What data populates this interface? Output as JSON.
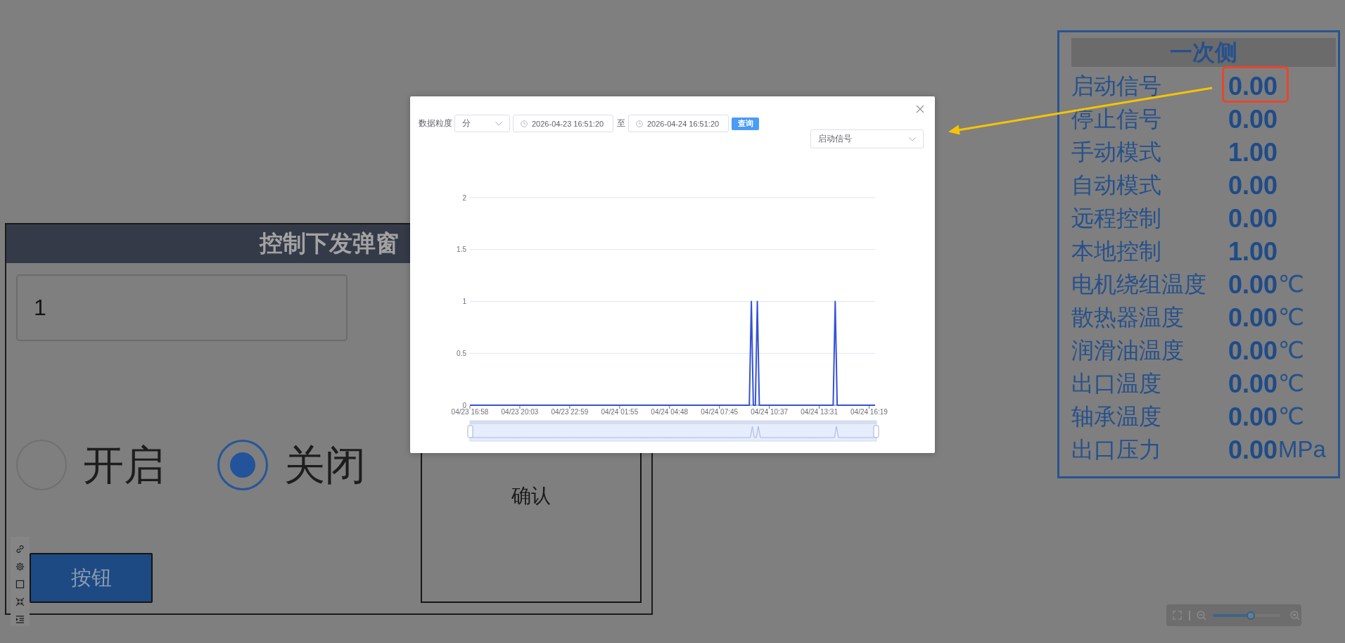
{
  "signal_panel": {
    "title": "一次侧",
    "rows": [
      {
        "label": "启动信号",
        "value": "0.00",
        "highlighted": true
      },
      {
        "label": "停止信号",
        "value": "0.00",
        "highlighted": false
      },
      {
        "label": "手动模式",
        "value": "1.00",
        "highlighted": false
      },
      {
        "label": "自动模式",
        "value": "0.00",
        "highlighted": false
      },
      {
        "label": "远程控制",
        "value": "0.00",
        "highlighted": false
      },
      {
        "label": "本地控制",
        "value": "1.00",
        "highlighted": false
      },
      {
        "label": "电机绕组温度",
        "value": "0.00",
        "unit": "℃",
        "highlighted": false
      },
      {
        "label": "散热器温度",
        "value": "0.00",
        "unit": "℃",
        "highlighted": false
      },
      {
        "label": "润滑油温度",
        "value": "0.00",
        "unit": "℃",
        "highlighted": false
      },
      {
        "label": "出口温度",
        "value": "0.00",
        "unit": "℃",
        "highlighted": false
      },
      {
        "label": "轴承温度",
        "value": "0.00",
        "unit": "℃",
        "highlighted": false
      },
      {
        "label": "出口压力",
        "value": "0.00",
        "unit": "MPa",
        "highlighted": false
      }
    ]
  },
  "history_dialog": {
    "granularity_label": "数据粒度",
    "granularity": "分",
    "start_time": "2026-04-23 16:51:20",
    "range_separator": "至",
    "end_time": "2026-04-24 16:51:20",
    "query_button": "查询",
    "signal": "启动信号",
    "chart_data": {
      "type": "line",
      "grid": true,
      "categories": [
        "04/23 16:58",
        null,
        null,
        null,
        null,
        null,
        null,
        null,
        null,
        null,
        null,
        null,
        null,
        null,
        null,
        null,
        null,
        null,
        null,
        null,
        null,
        null,
        null,
        null,
        null,
        "04/23 20:03",
        null,
        null,
        null,
        null,
        null,
        null,
        null,
        null,
        null,
        null,
        null,
        null,
        null,
        null,
        null,
        null,
        null,
        null,
        null,
        null,
        null,
        null,
        null,
        null,
        "04/23 22:59",
        null,
        null,
        null,
        null,
        null,
        null,
        null,
        null,
        null,
        null,
        null,
        null,
        null,
        null,
        null,
        null,
        null,
        null,
        null,
        null,
        null,
        null,
        null,
        null,
        "04/24 01:55",
        null,
        null,
        null,
        null,
        null,
        null,
        null,
        null,
        null,
        null,
        null,
        null,
        null,
        null,
        null,
        null,
        null,
        null,
        null,
        null,
        null,
        null,
        null,
        null,
        "04/24 04:48",
        null,
        null,
        null,
        null,
        null,
        null,
        null,
        null,
        null,
        null,
        null,
        null,
        null,
        null,
        null,
        null,
        null,
        null,
        null,
        null,
        null,
        null,
        null,
        null,
        "04/24 07:45",
        null,
        null,
        null,
        null,
        null,
        null,
        null,
        null,
        null,
        null,
        null,
        null,
        null,
        null,
        null,
        null,
        null,
        null,
        null,
        null,
        null,
        null,
        null,
        null,
        "04/24 10:37",
        null,
        null,
        null,
        null,
        null,
        null,
        null,
        null,
        null,
        null,
        null,
        null,
        null,
        null,
        null,
        null,
        null,
        null,
        null,
        null,
        null,
        null,
        null,
        null,
        "04/24 13:31",
        null,
        null,
        null,
        null,
        null,
        null,
        null,
        null,
        null,
        null,
        null,
        null,
        null,
        null,
        null,
        null,
        null,
        null,
        null,
        null,
        null,
        null,
        null,
        null,
        "04/24 16:19",
        null,
        null,
        null
      ],
      "values": [
        0,
        0,
        0,
        0,
        0,
        0,
        0,
        0,
        0,
        0,
        0,
        0,
        0,
        0,
        0,
        0,
        0,
        0,
        0,
        0,
        0,
        0,
        0,
        0,
        0,
        0,
        0,
        0,
        0,
        0,
        0,
        0,
        0,
        0,
        0,
        0,
        0,
        0,
        0,
        0,
        0,
        0,
        0,
        0,
        0,
        0,
        0,
        0,
        0,
        0,
        0,
        0,
        0,
        0,
        0,
        0,
        0,
        0,
        0,
        0,
        0,
        0,
        0,
        0,
        0,
        0,
        0,
        0,
        0,
        0,
        0,
        0,
        0,
        0,
        0,
        0,
        0,
        0,
        0,
        0,
        0,
        0,
        0,
        0,
        0,
        0,
        0,
        0,
        0,
        0,
        0,
        0,
        0,
        0,
        0,
        0,
        0,
        0,
        0,
        0,
        0,
        0,
        0,
        0,
        0,
        0,
        0,
        0,
        0,
        0,
        0,
        0,
        0,
        0,
        0,
        0,
        0,
        0,
        0,
        0,
        0,
        0,
        0,
        0,
        0,
        0,
        0,
        0,
        0,
        0,
        0,
        0,
        0,
        0,
        0,
        0,
        0,
        0,
        0,
        0,
        0,
        1,
        0,
        0,
        1,
        0,
        0,
        0,
        0,
        0,
        0,
        0,
        0,
        0,
        0,
        0,
        0,
        0,
        0,
        0,
        0,
        0,
        0,
        0,
        0,
        0,
        0,
        0,
        0,
        0,
        0,
        0,
        0,
        0,
        0,
        0,
        0,
        0,
        0,
        0,
        0,
        0,
        0,
        1,
        0,
        0,
        0,
        0,
        0,
        0,
        0,
        0,
        0,
        0,
        0,
        0,
        0,
        0,
        0,
        0,
        0,
        0,
        0,
        0
      ],
      "ylim": [
        0,
        2
      ],
      "yticks": [
        0,
        0.5,
        1,
        1.5,
        2
      ]
    }
  },
  "control_panel": {
    "title": "控制下发弹窗",
    "input": {
      "value": "1"
    },
    "radios": [
      {
        "label": "开启",
        "selected": false
      },
      {
        "label": "关闭",
        "selected": true
      }
    ],
    "confirm_label": "确认",
    "button_label": "按钮"
  },
  "zoom_control": {
    "level": 0.56
  }
}
